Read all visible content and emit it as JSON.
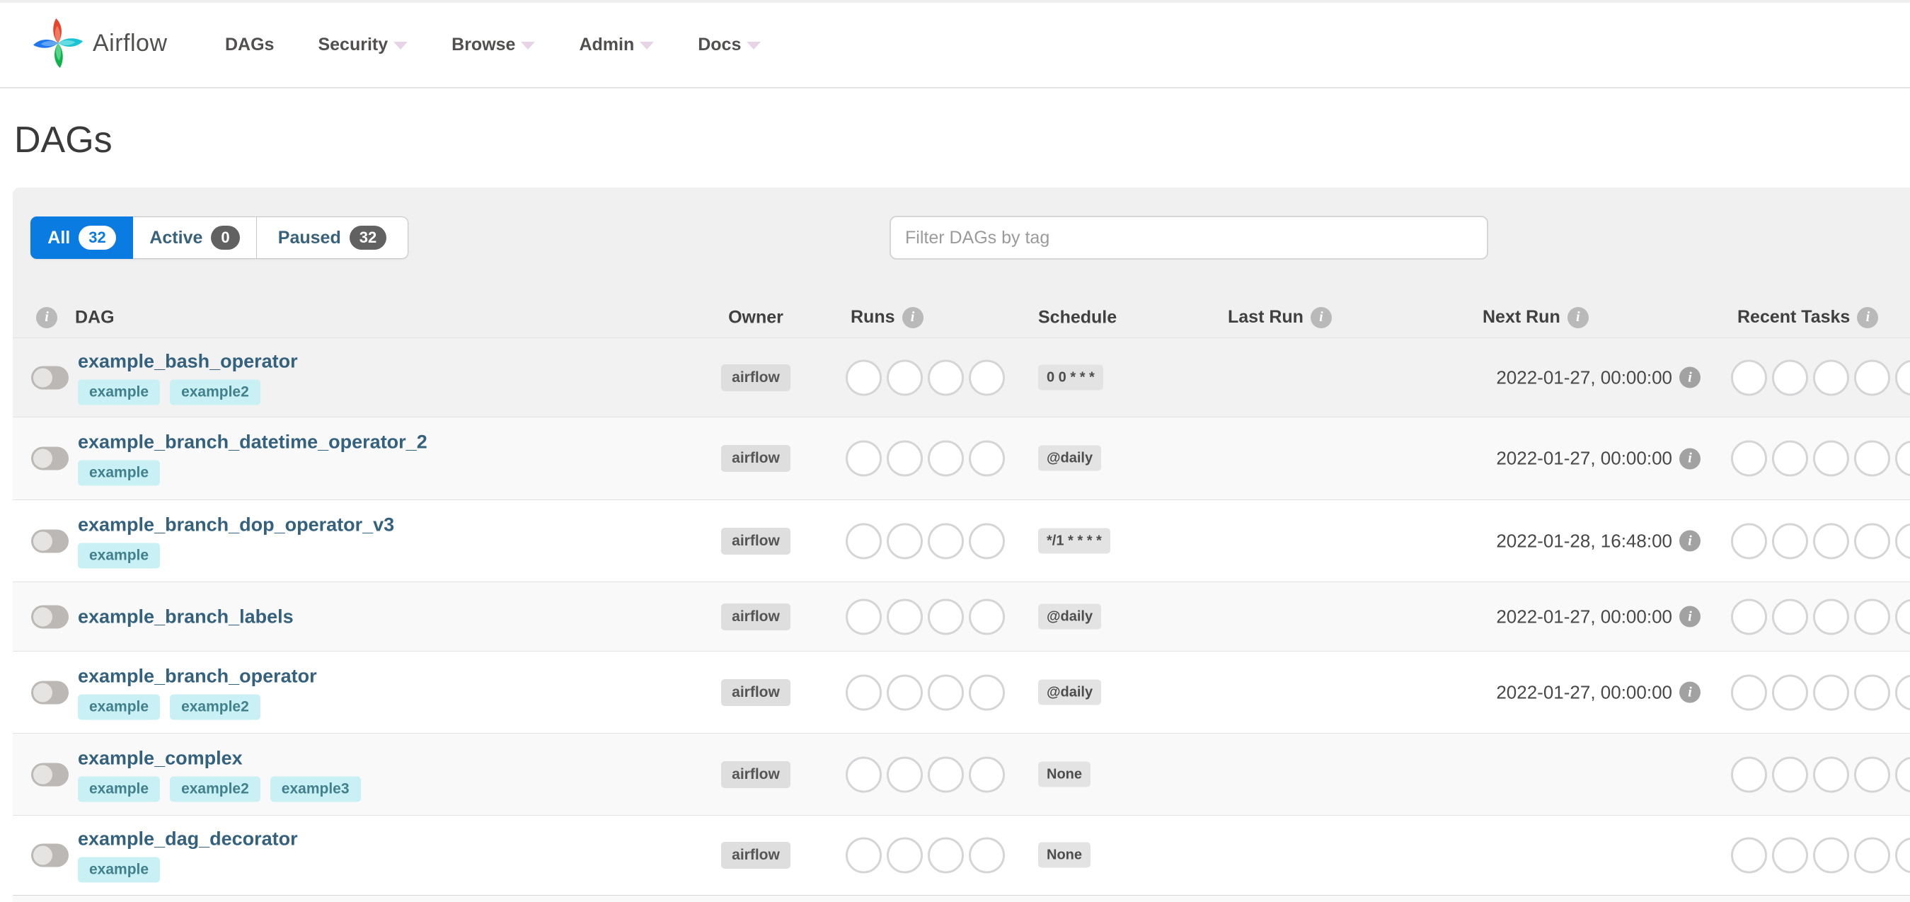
{
  "navbar": {
    "brand": "Airflow",
    "items": [
      {
        "label": "DAGs",
        "caret": false
      },
      {
        "label": "Security",
        "caret": true
      },
      {
        "label": "Browse",
        "caret": true
      },
      {
        "label": "Admin",
        "caret": true
      },
      {
        "label": "Docs",
        "caret": true
      }
    ]
  },
  "page": {
    "title": "DAGs"
  },
  "filters": {
    "tabs": [
      {
        "label": "All",
        "count": "32",
        "active": true
      },
      {
        "label": "Active",
        "count": "0",
        "active": false
      },
      {
        "label": "Paused",
        "count": "32",
        "active": false
      }
    ],
    "search_placeholder": "Filter DAGs by tag"
  },
  "table": {
    "headers": {
      "dag": "DAG",
      "owner": "Owner",
      "runs": "Runs",
      "schedule": "Schedule",
      "last_run": "Last Run",
      "next_run": "Next Run",
      "recent_tasks": "Recent Tasks"
    },
    "rows": [
      {
        "name": "example_bash_operator",
        "tags": [
          "example",
          "example2"
        ],
        "owner": "airflow",
        "schedule": "0 0 * * *",
        "last_run": "",
        "next_run": "2022-01-27, 00:00:00"
      },
      {
        "name": "example_branch_datetime_operator_2",
        "tags": [
          "example"
        ],
        "owner": "airflow",
        "schedule": "@daily",
        "last_run": "",
        "next_run": "2022-01-27, 00:00:00"
      },
      {
        "name": "example_branch_dop_operator_v3",
        "tags": [
          "example"
        ],
        "owner": "airflow",
        "schedule": "*/1 * * * *",
        "last_run": "",
        "next_run": "2022-01-28, 16:48:00"
      },
      {
        "name": "example_branch_labels",
        "tags": [],
        "owner": "airflow",
        "schedule": "@daily",
        "last_run": "",
        "next_run": "2022-01-27, 00:00:00"
      },
      {
        "name": "example_branch_operator",
        "tags": [
          "example",
          "example2"
        ],
        "owner": "airflow",
        "schedule": "@daily",
        "last_run": "",
        "next_run": "2022-01-27, 00:00:00"
      },
      {
        "name": "example_complex",
        "tags": [
          "example",
          "example2",
          "example3"
        ],
        "owner": "airflow",
        "schedule": "None",
        "last_run": "",
        "next_run": ""
      },
      {
        "name": "example_dag_decorator",
        "tags": [
          "example"
        ],
        "owner": "airflow",
        "schedule": "None",
        "last_run": "",
        "next_run": ""
      }
    ]
  },
  "colors": {
    "active_tab_blue": "#0a7be0",
    "nav_text": "#51504f",
    "dag_link": "#33617e",
    "tag_bg": "#c9f0f4",
    "tag_text": "#41808c",
    "badge_bg": "#dedede",
    "panel_bg": "#f0f0f0",
    "stripe_bg": "#f9f9f9",
    "logo_red": "#e5452f",
    "logo_teal": "#17c3d4",
    "logo_green": "#10b24c",
    "logo_blue": "#1e78ec"
  }
}
